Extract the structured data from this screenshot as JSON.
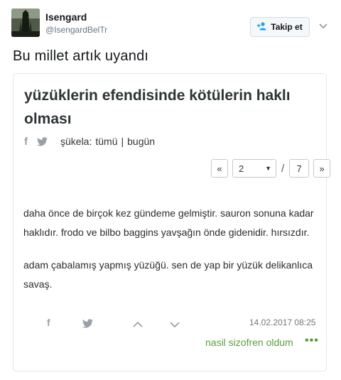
{
  "tweet": {
    "user": {
      "name": "Isengard",
      "handle": "@IsengardBelTr"
    },
    "follow_label": "Takip et",
    "text": "Bu millet artık uyandı"
  },
  "card": {
    "title": "yüzüklerin efendisinde kötülerin haklı olması",
    "sukela_label": "şükela:",
    "filter_all": "tümü",
    "filter_separator": "|",
    "filter_today": "bugün",
    "pager": {
      "prev": "«",
      "current_page": "2",
      "slash": "/",
      "total_pages": "7",
      "next": "»"
    },
    "entry_paragraphs": [
      "daha önce de birçok kez gündeme gelmiştir. sauron sonuna kadar haklıdır. frodo ve bilbo baggins yavşağın önde gidenidir. hırsızdır.",
      "adam çabalamış yapmış yüzüğü. sen de yap bir yüzük delikanlıca savaş."
    ],
    "date": "14.02.2017 08:25",
    "author": "nasil sizofren oldum",
    "more": "•••"
  },
  "colors": {
    "accent_blue": "#1da1f2",
    "author_green": "#5a9e3a",
    "icon_grey": "#9aa0a6"
  },
  "icons": {
    "follow": "add-user-icon",
    "menu": "chevron-down-icon",
    "facebook": "facebook-icon",
    "twitter": "twitter-icon",
    "upvote": "chevron-up-icon",
    "downvote": "chevron-down-icon",
    "more": "more-dots-icon"
  }
}
